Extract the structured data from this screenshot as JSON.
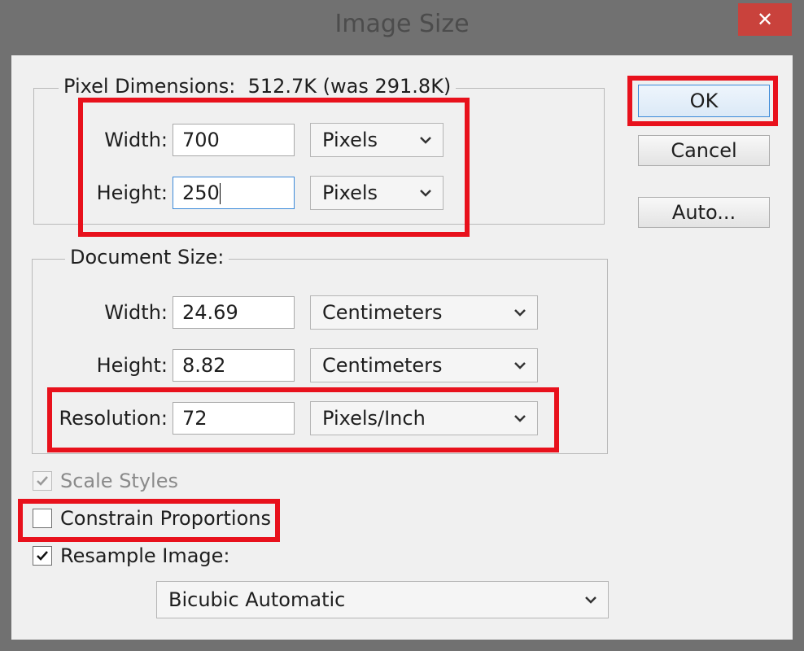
{
  "window": {
    "title": "Image Size",
    "close_glyph": "✕"
  },
  "pixel_dimensions": {
    "legend": "Pixel Dimensions:",
    "size_info": "512.7K (was 291.8K)",
    "width_label": "Width:",
    "width_value": "700",
    "width_unit": "Pixels",
    "height_label": "Height:",
    "height_value": "250",
    "height_unit": "Pixels"
  },
  "document_size": {
    "legend": "Document Size:",
    "width_label": "Width:",
    "width_value": "24.69",
    "width_unit": "Centimeters",
    "height_label": "Height:",
    "height_value": "8.82",
    "height_unit": "Centimeters",
    "resolution_label": "Resolution:",
    "resolution_value": "72",
    "resolution_unit": "Pixels/Inch"
  },
  "options": {
    "scale_styles_label": "Scale Styles",
    "scale_styles_checked": true,
    "scale_styles_enabled": false,
    "constrain_label": "Constrain Proportions",
    "constrain_checked": false,
    "resample_label": "Resample Image:",
    "resample_checked": true,
    "resample_method": "Bicubic Automatic"
  },
  "buttons": {
    "ok": "OK",
    "cancel": "Cancel",
    "auto": "Auto..."
  },
  "icons": {
    "dropdown": "chevron-down-icon",
    "check": "checkmark-icon",
    "close": "close-icon"
  },
  "colors": {
    "highlight": "#e8111c",
    "focus_border": "#3c8ad9",
    "title_bar": "#717171",
    "close_button": "#c9423c"
  }
}
